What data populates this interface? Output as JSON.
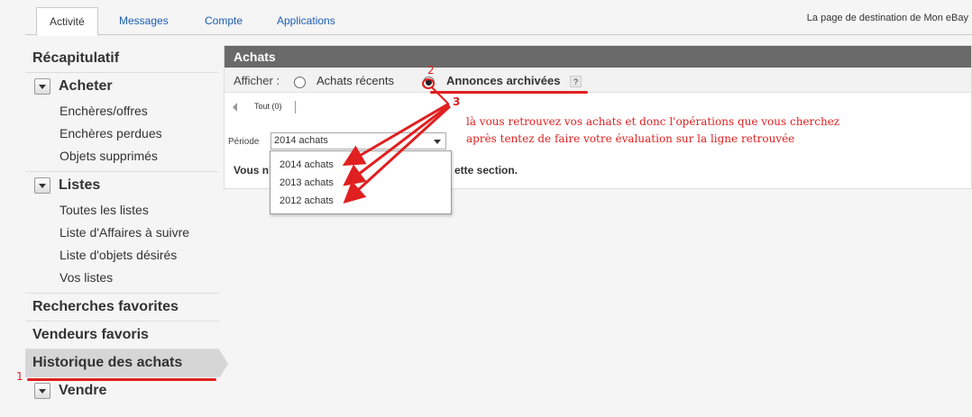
{
  "tabs": [
    {
      "label": "Activité",
      "active": true
    },
    {
      "label": "Messages"
    },
    {
      "label": "Compte"
    },
    {
      "label": "Applications"
    }
  ],
  "top_right_link": "La page de destination de Mon eBay",
  "sidebar": {
    "recap": "Récapitulatif",
    "acheter": {
      "title": "Acheter",
      "items": [
        "Enchères/offres",
        "Enchères perdues",
        "Objets supprimés"
      ]
    },
    "listes": {
      "title": "Listes",
      "items": [
        "Toutes les listes",
        "Liste d'Affaires à suivre",
        "Liste d'objets désirés",
        "Vos listes"
      ]
    },
    "recherches": "Recherches favorites",
    "vendeurs": "Vendeurs favoris",
    "historique": "Historique des achats",
    "vendre": "Vendre"
  },
  "panel": {
    "title": "Achats",
    "afficher": "Afficher :",
    "option1": "Achats récents",
    "option2": "Annonces archivées",
    "help": "?",
    "tout": "Tout (0)",
    "periode_label": "Période",
    "periode_value": "2014 achats",
    "msg_left": "Vous n'",
    "msg_right": "ette section."
  },
  "dropdown": [
    "2014 achats",
    "2013 achats",
    "2012 achats"
  ],
  "annotations": {
    "n1": "1",
    "n2": "2",
    "n3": "3",
    "line1": "là vous retrouvez vos achats et donc l'opérations que vous cherchez",
    "line2": "après tentez de faire votre évaluation sur la ligne retrouvée",
    "color": "#e02020"
  }
}
